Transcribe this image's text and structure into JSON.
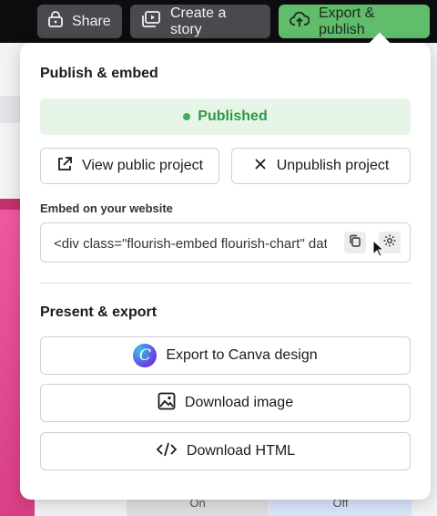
{
  "topbar": {
    "share_label": "Share",
    "story_label": "Create a story",
    "export_label": "Export & publish"
  },
  "popover": {
    "publish_title": "Publish & embed",
    "status_text": "Published",
    "view_public_label": "View public project",
    "unpublish_label": "Unpublish project",
    "embed_label": "Embed on your website",
    "embed_value": "<div class=\"flourish-embed flourish-chart\" data-src=\"visualisation\"></div>",
    "present_title": "Present & export",
    "canva_label": "Export to Canva design",
    "download_image_label": "Download image",
    "download_html_label": "Download HTML"
  },
  "background": {
    "cell_on": "On",
    "cell_off": "Off"
  },
  "colors": {
    "accent_green": "#5fbd6b",
    "published_green": "#2f9a45",
    "pink": "#e44b91"
  }
}
